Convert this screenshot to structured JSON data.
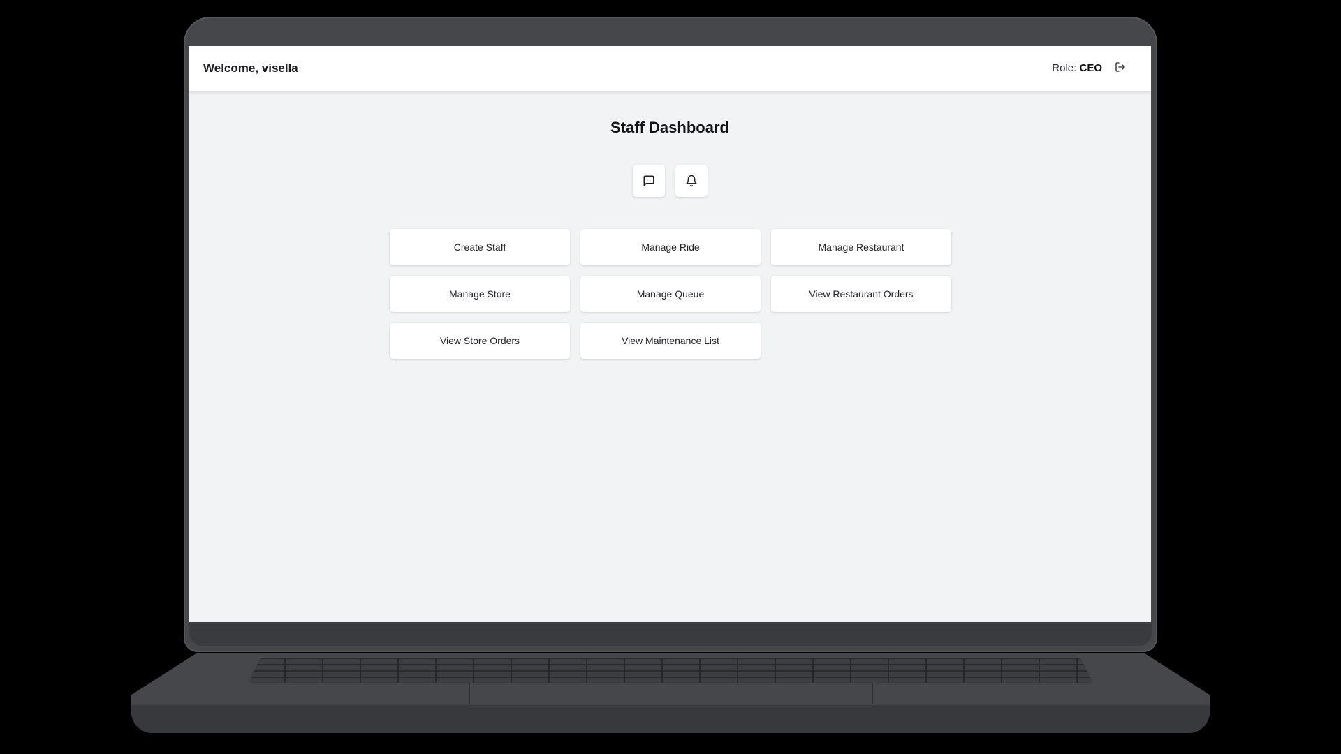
{
  "header": {
    "welcome": "Welcome, visella",
    "role_label": "Role:",
    "role_value": "CEO"
  },
  "page": {
    "title": "Staff Dashboard"
  },
  "icons": {
    "chat": "message-square-icon",
    "bell": "bell-icon",
    "logout": "log-out-icon"
  },
  "actions": [
    {
      "label": "Create Staff"
    },
    {
      "label": "Manage Ride"
    },
    {
      "label": "Manage Restaurant"
    },
    {
      "label": "Manage Store"
    },
    {
      "label": "Manage Queue"
    },
    {
      "label": "View Restaurant Orders"
    },
    {
      "label": "View Store Orders"
    },
    {
      "label": "View Maintenance List"
    }
  ]
}
